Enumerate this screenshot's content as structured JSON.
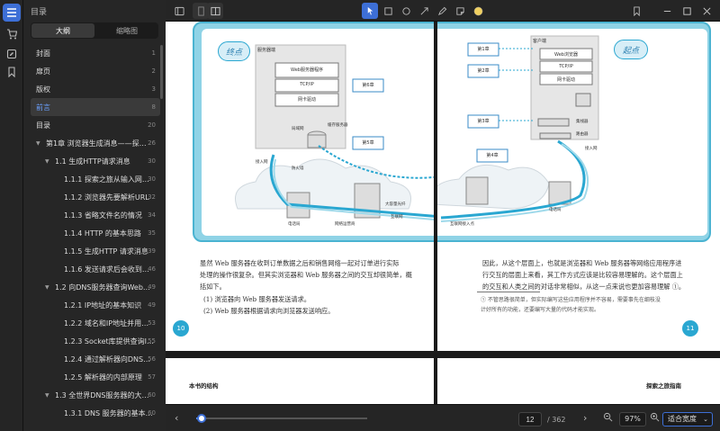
{
  "sidebar": {
    "title": "目录",
    "tabs": [
      "大纲",
      "缩略图"
    ],
    "items": [
      {
        "label": "封面",
        "page": "1",
        "level": 0,
        "toggle": ""
      },
      {
        "label": "扉页",
        "page": "2",
        "level": 0,
        "toggle": ""
      },
      {
        "label": "版权",
        "page": "3",
        "level": 0,
        "toggle": ""
      },
      {
        "label": "前言",
        "page": "8",
        "level": 0,
        "toggle": "",
        "selected": true
      },
      {
        "label": "目录",
        "page": "20",
        "level": 0,
        "toggle": ""
      },
      {
        "label": "第1章 浏览器生成消息——探…",
        "page": "26",
        "level": 0,
        "toggle": "▼"
      },
      {
        "label": "1.1 生成HTTP请求消息",
        "page": "30",
        "level": 1,
        "toggle": "▼"
      },
      {
        "label": "1.1.1 探索之旅从输入网…",
        "page": "30",
        "level": 2,
        "toggle": ""
      },
      {
        "label": "1.1.2 浏览器先要解析URL",
        "page": "32",
        "level": 2,
        "toggle": ""
      },
      {
        "label": "1.1.3 省略文件名的情况",
        "page": "34",
        "level": 2,
        "toggle": ""
      },
      {
        "label": "1.1.4 HTTP 的基本思路",
        "page": "35",
        "level": 2,
        "toggle": ""
      },
      {
        "label": "1.1.5 生成HTTP 请求消息",
        "page": "39",
        "level": 2,
        "toggle": ""
      },
      {
        "label": "1.1.6 发送请求后会收到…",
        "page": "46",
        "level": 2,
        "toggle": ""
      },
      {
        "label": "1.2 向DNS服务器查询Web…",
        "page": "49",
        "level": 1,
        "toggle": "▼"
      },
      {
        "label": "1.2.1 IP地址的基本知识",
        "page": "49",
        "level": 2,
        "toggle": ""
      },
      {
        "label": "1.2.2 域名和IP地址并用…",
        "page": "53",
        "level": 2,
        "toggle": ""
      },
      {
        "label": "1.2.3 Socket库提供查询I…",
        "page": "55",
        "level": 2,
        "toggle": ""
      },
      {
        "label": "1.2.4 通过解析器向DNS…",
        "page": "56",
        "level": 2,
        "toggle": ""
      },
      {
        "label": "1.2.5 解析器的内部原理",
        "page": "57",
        "level": 2,
        "toggle": ""
      },
      {
        "label": "1.3 全世界DNS服务器的大…",
        "page": "60",
        "level": 1,
        "toggle": "▼"
      },
      {
        "label": "1.3.1 DNS 服务器的基本…",
        "page": "60",
        "level": 2,
        "toggle": ""
      }
    ]
  },
  "page_left": {
    "badge": "终点",
    "server_title": "服务器端",
    "stack": [
      "Web服务器程序",
      "TCP/IP",
      "网卡驱动"
    ],
    "chapters": [
      "第6章",
      "第5章"
    ],
    "labels": [
      "局域网",
      "防火墙",
      "缓存服务器",
      "接入网",
      "电话局",
      "网络运营商",
      "互联网",
      "大容量光纤"
    ],
    "para": [
      "虽然 Web 服务器在收到订单数据之后和销售网络一起对订单进行实际",
      "处理的操作很复杂。但其实浏览器和 Web 服务器之间的交互却很简单，概",
      "括如下。"
    ],
    "list": [
      "(1) 浏览器向 Web 服务器发送请求。",
      "(2) Web 服务器根据请求向浏览器发送响应。"
    ],
    "page_number": "10",
    "footer": "本书的结构"
  },
  "page_right": {
    "badge": "起点",
    "client_title": "客户端",
    "stack": [
      "Web浏览器",
      "TCP/IP",
      "网卡驱动"
    ],
    "chapters": [
      "第1章",
      "第2章",
      "第3章",
      "第4章"
    ],
    "labels": [
      "集线器",
      "路由器",
      "接入网",
      "电话局",
      "互联网接入点"
    ],
    "para": [
      "因此，从这个层面上，也就是浏览器和 Web 服务器等网络应用程序进",
      "行交互的层面上来看，其工作方式应该是比较容易理解的。这个层面上",
      "的交互和人类之间的对话非常相似，从这一点来说也更加容易理解 ①。"
    ],
    "footnote": [
      "①  不管思路很简单，但实际编写这些应用程序并不容易，需要事先在细枝没",
      "计好所有的功能，还要编写大量的代码才能实现。"
    ],
    "page_number": "11",
    "footer": "探索之旅指南"
  },
  "bottom": {
    "current_page": "12",
    "total_pages": "/ 362",
    "zoom": "97%",
    "fit_mode": "适合宽度",
    "progress": 0.03
  },
  "colors": {
    "accent": "#3d6fd6",
    "diagram_bg": "#8fd3e6",
    "badge": "#2aa7d1",
    "annot_yellow": "#f0d060"
  }
}
